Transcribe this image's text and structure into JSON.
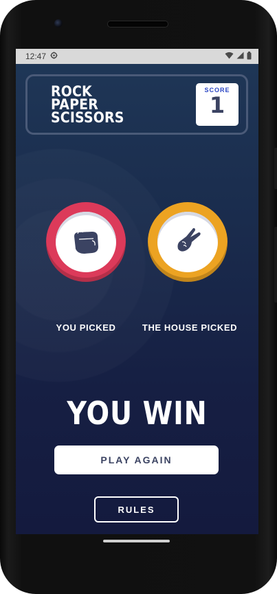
{
  "status_bar": {
    "time": "12:47",
    "gear_icon": "settings-gear-icon",
    "icons": [
      "wifi-icon",
      "signal-icon",
      "battery-icon"
    ]
  },
  "header": {
    "title_lines": [
      "ROCK",
      "PAPER",
      "SCISSORS"
    ],
    "score_label": "SCORE",
    "score_value": "1"
  },
  "game": {
    "you_picked_label": "YOU PICKED",
    "house_picked_label": "THE HOUSE PICKED",
    "player_choice": {
      "name": "rock",
      "icon": "rock-fist-icon",
      "color": "#dc3a5a"
    },
    "house_choice": {
      "name": "scissors",
      "icon": "scissors-hand-icon",
      "color": "#eca322"
    }
  },
  "result": {
    "text": "YOU WIN",
    "play_again_label": "PLAY AGAIN",
    "rules_label": "RULES"
  },
  "colors": {
    "background_top": "#1f3757",
    "background_bottom": "#141a3e",
    "text_dark": "#3b4362",
    "score_label": "#2b46c4"
  }
}
